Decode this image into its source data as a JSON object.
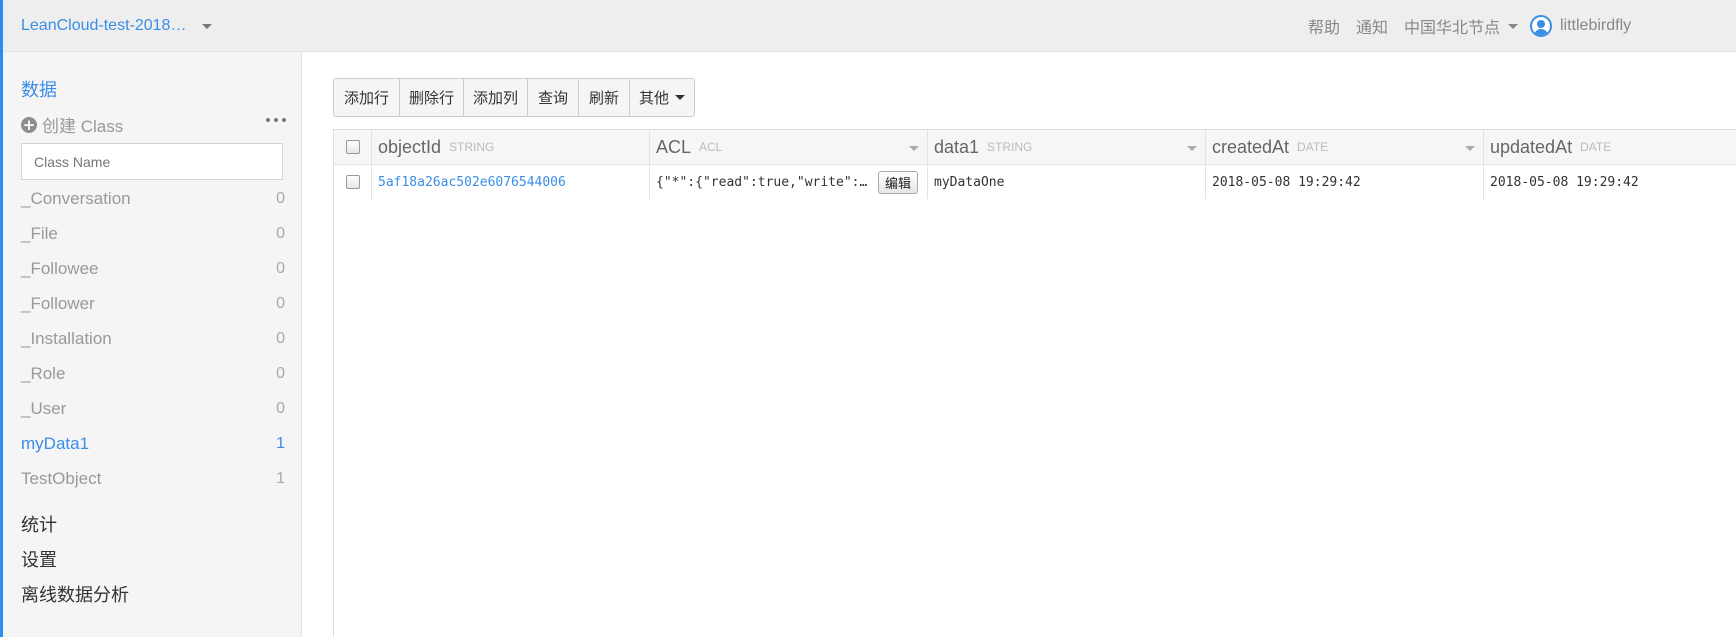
{
  "topbar": {
    "app_name": "LeanCloud-test-2018…",
    "help": "帮助",
    "notifications": "通知",
    "region": "中国华北节点",
    "username": "littlebirdfly"
  },
  "sidebar": {
    "title": "数据",
    "create_class": "创建 Class",
    "class_filter_placeholder": "Class Name",
    "classes": [
      {
        "name": "_Conversation",
        "count": "0"
      },
      {
        "name": "_File",
        "count": "0"
      },
      {
        "name": "_Followee",
        "count": "0"
      },
      {
        "name": "_Follower",
        "count": "0"
      },
      {
        "name": "_Installation",
        "count": "0"
      },
      {
        "name": "_Role",
        "count": "0"
      },
      {
        "name": "_User",
        "count": "0"
      },
      {
        "name": "myData1",
        "count": "1"
      },
      {
        "name": "TestObject",
        "count": "1"
      }
    ],
    "menu": [
      "统计",
      "设置",
      "离线数据分析"
    ]
  },
  "toolbar": {
    "add_row": "添加行",
    "delete_row": "删除行",
    "add_column": "添加列",
    "query": "查询",
    "refresh": "刷新",
    "more": "其他"
  },
  "table": {
    "columns": [
      {
        "name": "objectId",
        "type": "STRING"
      },
      {
        "name": "ACL",
        "type": "ACL"
      },
      {
        "name": "data1",
        "type": "STRING"
      },
      {
        "name": "createdAt",
        "type": "DATE"
      },
      {
        "name": "updatedAt",
        "type": "DATE"
      }
    ],
    "rows": [
      {
        "objectId": "5af18a26ac502e6076544006",
        "acl": "{\"*\":{\"read\":true,\"write\":true}}",
        "edit_label": "编辑",
        "data1": "myDataOne",
        "createdAt": "2018-05-08 19:29:42",
        "updatedAt": "2018-05-08 19:29:42"
      }
    ]
  },
  "colors": {
    "accent": "#3a8ee6",
    "topbar_bg": "#eeeeee",
    "sidebar_bg": "#f5f5f5"
  },
  "icons": [
    "chevron-down-icon",
    "plus-circle-icon",
    "more-dots-icon",
    "user-avatar-icon",
    "checkbox-icon",
    "sort-caret-icon"
  ]
}
